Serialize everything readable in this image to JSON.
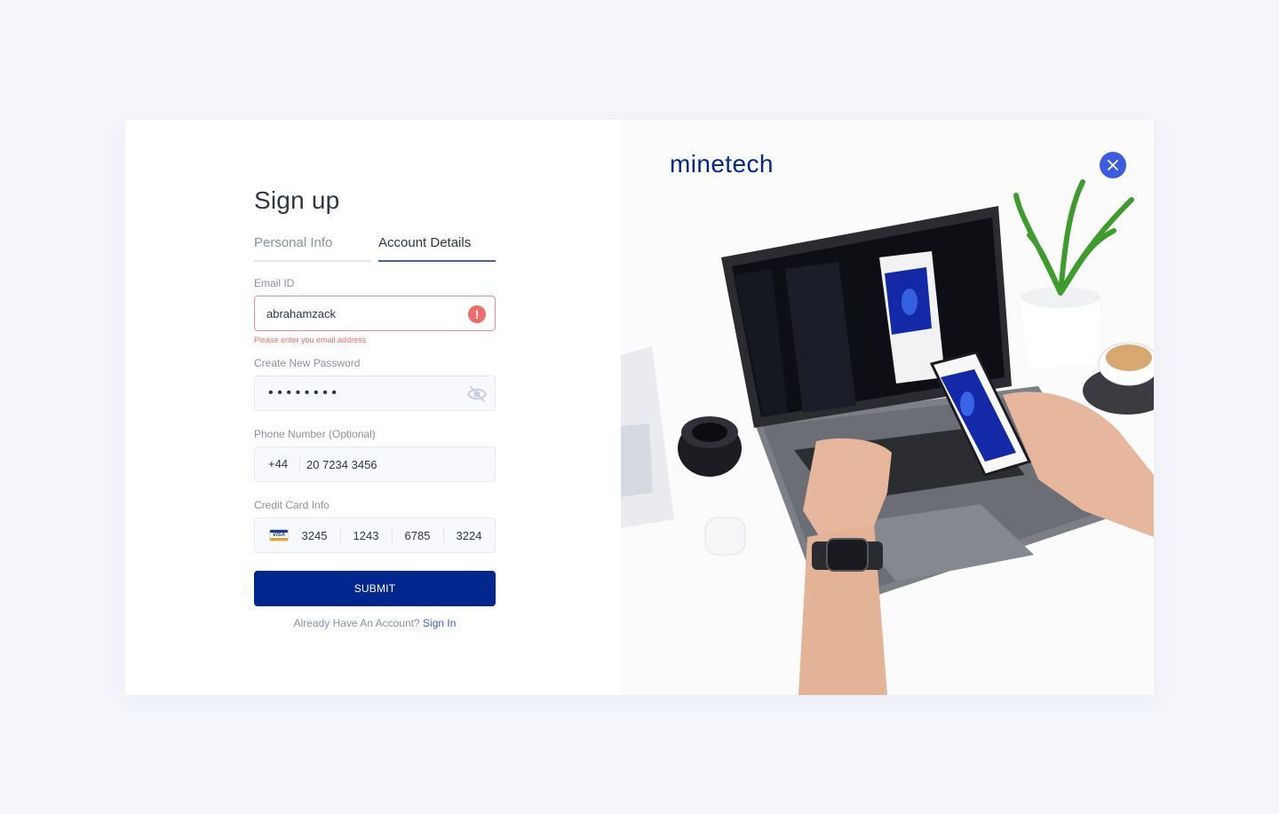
{
  "brand": {
    "name": "minetech"
  },
  "form": {
    "title": "Sign up",
    "tabs": [
      {
        "label": "Personal Info",
        "active": false
      },
      {
        "label": "Account Details",
        "active": true
      }
    ],
    "email": {
      "label": "Email ID",
      "value": "abrahamzack",
      "error": "Please enter you email address"
    },
    "password": {
      "label": "Create New Password",
      "masked": "••••••••"
    },
    "phone": {
      "label": "Phone Number (Optional)",
      "country_code": "+44",
      "value": "20 7234 3456"
    },
    "card": {
      "label": "Credit Card Info",
      "brand_icon": "visa-icon",
      "brand_text": "VISA",
      "segments": [
        "3245",
        "1243",
        "6785",
        "3224"
      ]
    },
    "submit_label": "SUBMIT",
    "footer": {
      "prompt": "Already Have An Account?",
      "link": "Sign In"
    }
  },
  "colors": {
    "primary": "#01278f",
    "accent": "#3d5be0",
    "error": "#f06b6b",
    "background": "#f4f6fb"
  },
  "icons": [
    "error-icon",
    "eye-off-icon",
    "visa-icon",
    "close-icon"
  ]
}
